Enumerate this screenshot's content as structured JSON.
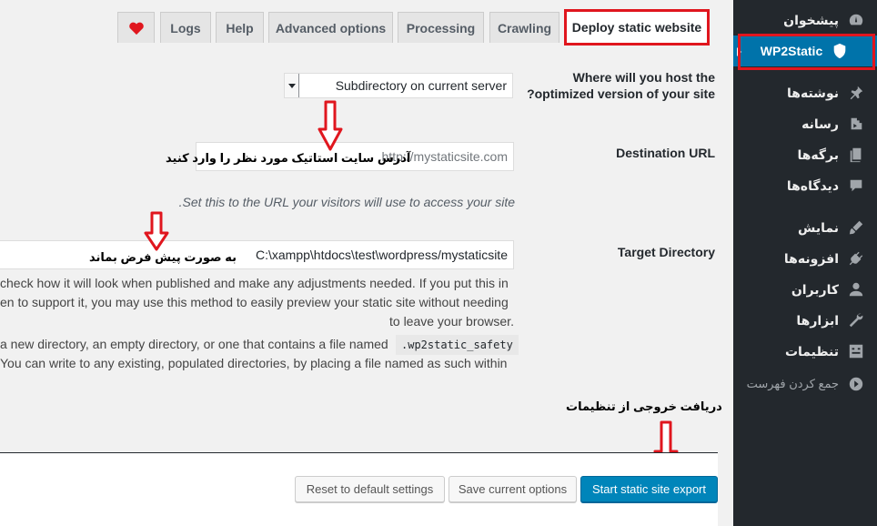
{
  "sidebar": {
    "items": [
      {
        "label": "پیشخوان",
        "icon": "dashboard-icon"
      },
      {
        "label": "WP2Static",
        "icon": "shield-icon",
        "active": true
      },
      {
        "label": "نوشته‌ها",
        "icon": "pin-icon"
      },
      {
        "label": "رسانه",
        "icon": "media-icon"
      },
      {
        "label": "برگه‌ها",
        "icon": "pages-icon"
      },
      {
        "label": "دیدگاه‌ها",
        "icon": "comments-icon"
      },
      {
        "label": "نمایش",
        "icon": "appearance-icon"
      },
      {
        "label": "افزونه‌ها",
        "icon": "plugins-icon"
      },
      {
        "label": "کاربران",
        "icon": "users-icon"
      },
      {
        "label": "ابزارها",
        "icon": "tools-icon"
      },
      {
        "label": "تنظیمات",
        "icon": "settings-icon"
      },
      {
        "label": "جمع کردن فهرست",
        "icon": "collapse-icon"
      }
    ]
  },
  "tabs": [
    {
      "label": "Deploy static website",
      "active": true
    },
    {
      "label": "Crawling"
    },
    {
      "label": "Processing"
    },
    {
      "label": "Advanced options"
    },
    {
      "label": "Help"
    },
    {
      "label": "Logs"
    },
    {
      "label": "",
      "icon": "heart-icon"
    }
  ],
  "form": {
    "host": {
      "label_line1": "Where will you host the",
      "label_line2": "optimized version of your site?",
      "selected": "Subdirectory on current server"
    },
    "destination": {
      "label": "Destination URL",
      "placeholder": "http://mystaticsite.com",
      "help": "Set this to the URL your visitors will use to access your site."
    },
    "target": {
      "label": "Target Directory",
      "value": "C:\\xampp\\htdocs\\test\\wordpress/mystaticsite",
      "desc_line1": "check how it will look when published and make any adjustments needed. If you put this in",
      "desc_line2": "en to support it, you may use this method to easily preview your static site without needing",
      "desc_line3": "to leave your browser.",
      "desc_line4": "a new directory, an empty directory, or one that contains a file named",
      "desc_code": ".wp2static_safety",
      "desc_line5": " You can write to any existing, populated directories, by placing a file named as such within"
    }
  },
  "annotations": {
    "destination_note": "آدرس سایت استاتیک مورد نظر را وارد کنید",
    "target_note": "به صورت پیش فرض بماند",
    "export_note": "دریافت خروجی از تنظیمات"
  },
  "buttons": {
    "reset": "Reset to default settings",
    "save": "Save current options",
    "export": "Start static site export"
  },
  "colors": {
    "admin_bar": "#23282d",
    "active_menu": "#0073aa",
    "primary_button": "#0085ba",
    "highlight_red": "#e0161e"
  }
}
